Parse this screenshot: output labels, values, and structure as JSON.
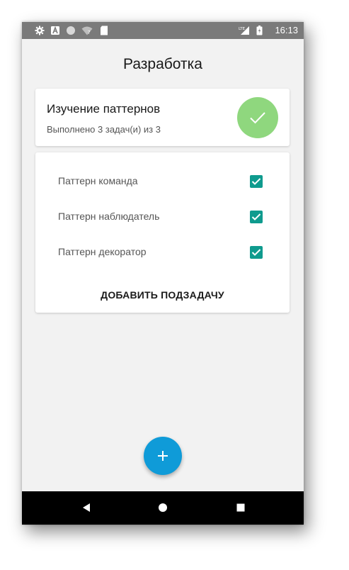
{
  "status_bar": {
    "time": "16:13",
    "icons": [
      "gear-icon",
      "a-notification-icon",
      "circle-icon",
      "wifi-icon",
      "sd-card-icon",
      "lte-signal-icon",
      "battery-icon"
    ],
    "network": "LTE"
  },
  "header": {
    "title": "Разработка"
  },
  "task": {
    "title": "Изучение паттернов",
    "progress": "Выполнено 3 задач(и) из 3",
    "status_icon": "check-icon",
    "status_color": "#8fd77e"
  },
  "subtasks": {
    "items": [
      {
        "label": "Паттерн команда",
        "checked": true
      },
      {
        "label": "Паттерн наблюдатель",
        "checked": true
      },
      {
        "label": "Паттерн декоратор",
        "checked": true
      }
    ],
    "add_label": "ДОБАВИТЬ ПОДЗАДАЧУ"
  },
  "fab": {
    "icon": "plus-icon",
    "color": "#0f9bd8"
  },
  "nav": {
    "icons": [
      "back-icon",
      "home-icon",
      "recents-icon"
    ]
  },
  "colors": {
    "checkbox": "#0f9b8e",
    "status_bar": "#7a7a7a",
    "background": "#f2f2f2"
  }
}
